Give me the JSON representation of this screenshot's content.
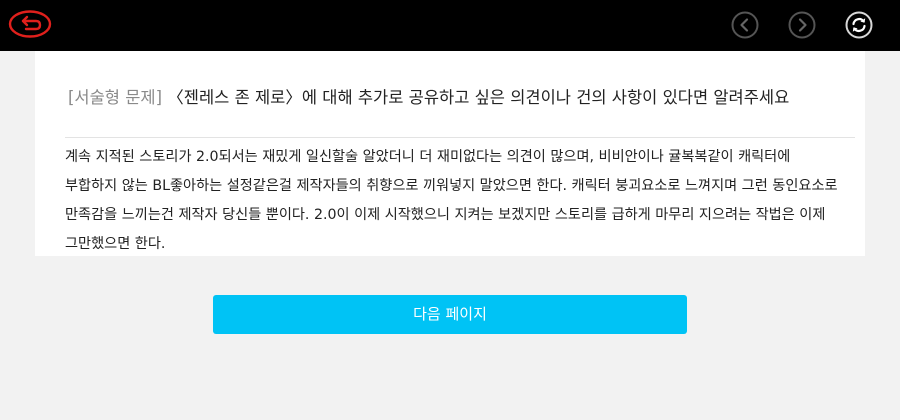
{
  "header": {
    "back_icon": "back-arrow-icon",
    "prev_icon": "chevron-left-icon",
    "next_icon": "chevron-right-icon",
    "refresh_icon": "refresh-icon",
    "accent_color": "#e0201c"
  },
  "question": {
    "tag": "[서술형 문제]",
    "text": "〈젠레스 존 제로〉에 대해 추가로 공유하고 싶은 의견이나 건의 사항이 있다면 알려주세요"
  },
  "answer": {
    "text": "계속 지적된 스토리가 2.0되서는 재밌게 일신할술 알았더니 더 재미없다는 의견이 많으며, 비비안이나 귤복복같이 캐릭터에 부합하지 않는 BL좋아하는 설정같은걸 제작자들의 취향으로 끼워넣지 말았으면 한다. 캐릭터 붕괴요소로 느껴지며 그런 동인요소로 만족감을 느끼는건 제작자 당신들 뿐이다. 2.0이 이제 시작했으니 지켜는 보겠지만 스토리를 급하게 마무리 지으려는 작법은 이제 그만했으면 한다."
  },
  "footer": {
    "next_page_label": "다음 페이지",
    "button_color": "#00c3f5"
  }
}
